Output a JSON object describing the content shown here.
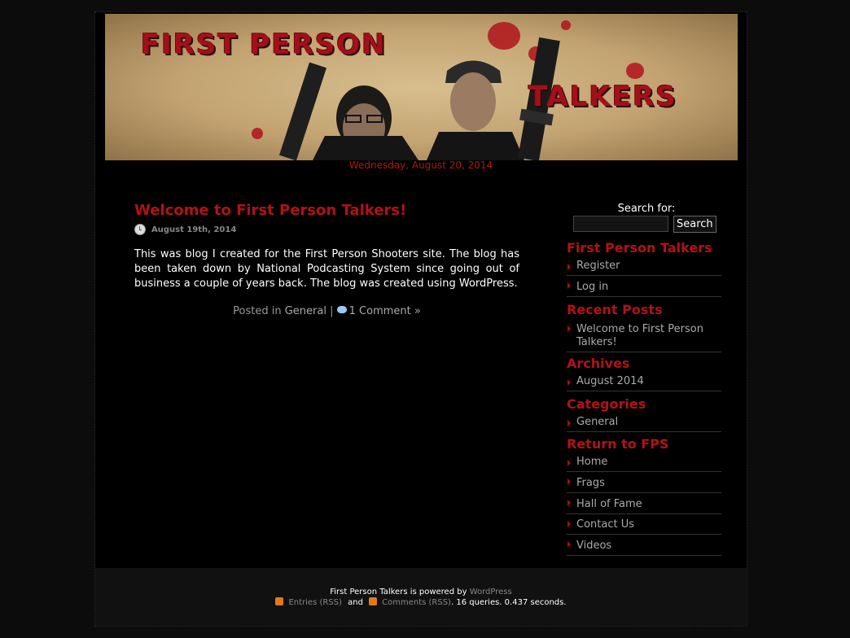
{
  "header": {
    "logo_line1": "FIRST PERSON",
    "logo_line2": "TALKERS"
  },
  "date_line": "Wednesday, August 20, 2014",
  "post": {
    "title": "Welcome to First Person Talkers!",
    "date": "August 19th, 2014",
    "body": "This was  blog I created for the First Person Shooters site. The blog has been taken down by National Podcasting System since going out of business a couple of years back. The blog was created using WordPress.",
    "posted_in": "Posted in",
    "category": "General",
    "separator": "|",
    "comments": "1 Comment »"
  },
  "search": {
    "label": "Search for:",
    "placeholder": "",
    "button": "Search"
  },
  "widgets": {
    "site": {
      "title": "First Person Talkers",
      "items": [
        "Register",
        "Log in"
      ]
    },
    "recent": {
      "title": "Recent Posts",
      "items": [
        "Welcome to First Person Talkers!"
      ]
    },
    "archives": {
      "title": "Archives",
      "items": [
        "August 2014"
      ]
    },
    "categories": {
      "title": "Categories",
      "items": [
        "General"
      ]
    },
    "fps": {
      "title": "Return to FPS",
      "items": [
        "Home",
        "Frags",
        "Hall of Fame",
        "Contact Us",
        "Videos"
      ]
    }
  },
  "footer": {
    "powered_prefix": "First Person Talkers is powered by",
    "powered_link": "WordPress",
    "entries": "Entries (RSS)",
    "and": "and",
    "comments": "Comments (RSS)",
    "stats": ". 16 queries. 0.437 seconds."
  },
  "colors": {
    "accent": "#b01218",
    "background": "#000000",
    "text": "#ffffff"
  },
  "icons": [
    "clock-icon",
    "comment-icon",
    "rss-icon",
    "arrow-bullet-icon"
  ]
}
